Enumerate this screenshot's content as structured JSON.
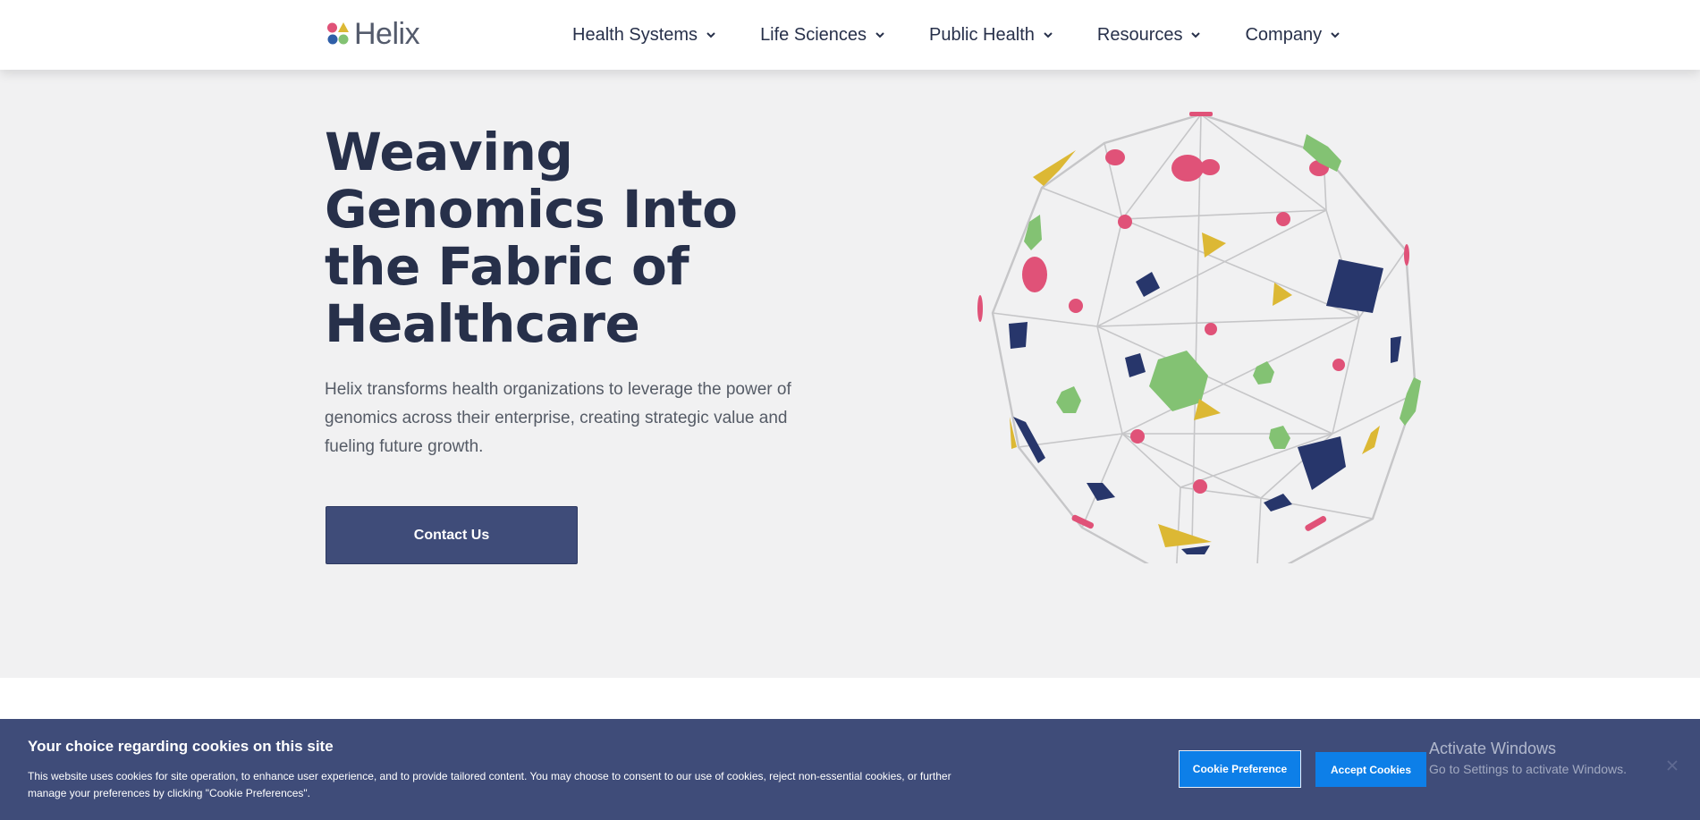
{
  "brand": {
    "name": "Helix"
  },
  "nav": {
    "items": [
      {
        "label": "Health Systems"
      },
      {
        "label": "Life Sciences"
      },
      {
        "label": "Public Health"
      },
      {
        "label": "Resources"
      },
      {
        "label": "Company"
      }
    ]
  },
  "hero": {
    "title_lines": [
      "Weaving",
      "Genomics Into",
      "the Fabric of",
      "Healthcare"
    ],
    "description": "Helix transforms health organizations to leverage the power of genomics across their enterprise, creating strategic value and fueling future growth.",
    "cta_label": "Contact Us"
  },
  "colors": {
    "navy": "#27304a",
    "button": "#3f4c79",
    "pink": "#e05278",
    "green": "#83c273",
    "yellow": "#dcb834",
    "shape_navy": "#27366b",
    "cookie_bg": "#3f4c79",
    "cookie_button": "#0d7fe8"
  },
  "cookie": {
    "title": "Your choice regarding cookies on this site",
    "text": "This website uses cookies for site operation, to enhance user experience, and to provide tailored content. You may choose to consent to our use of cookies, reject non-essential cookies, or further manage your preferences by clicking \"Cookie Preferences\".",
    "preference_label": "Cookie Preference",
    "accept_label": "Accept Cookies"
  },
  "os_overlay": {
    "title": "Activate Windows",
    "subtitle": "Go to Settings to activate Windows."
  }
}
